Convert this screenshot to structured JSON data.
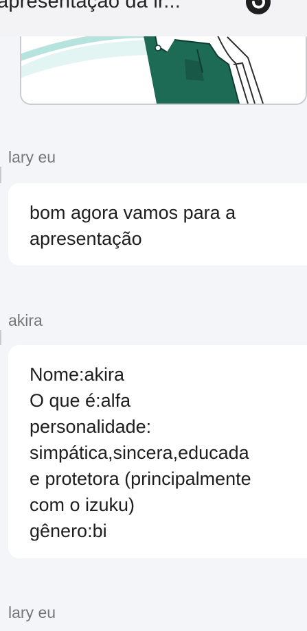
{
  "header": {
    "title": "apresentaçao da ir...",
    "reload_icon": "reload-icon"
  },
  "messages": [
    {
      "sender": "lary eu",
      "text": "bom agora vamos para a\napresentação"
    },
    {
      "sender": "akira",
      "text": "Nome:akira\nO que é:alfa\npersonalidade:\nsimpática,sincera,educada\ne protetora (principalmente\ncom o izuku)\ngênero:bi"
    },
    {
      "sender": "lary eu"
    }
  ],
  "colors": {
    "background": "#f4f5f8",
    "bubble": "#ffffff",
    "sender": "#767676",
    "text": "#1e1e1e",
    "image_teal": "#1e6b55"
  }
}
